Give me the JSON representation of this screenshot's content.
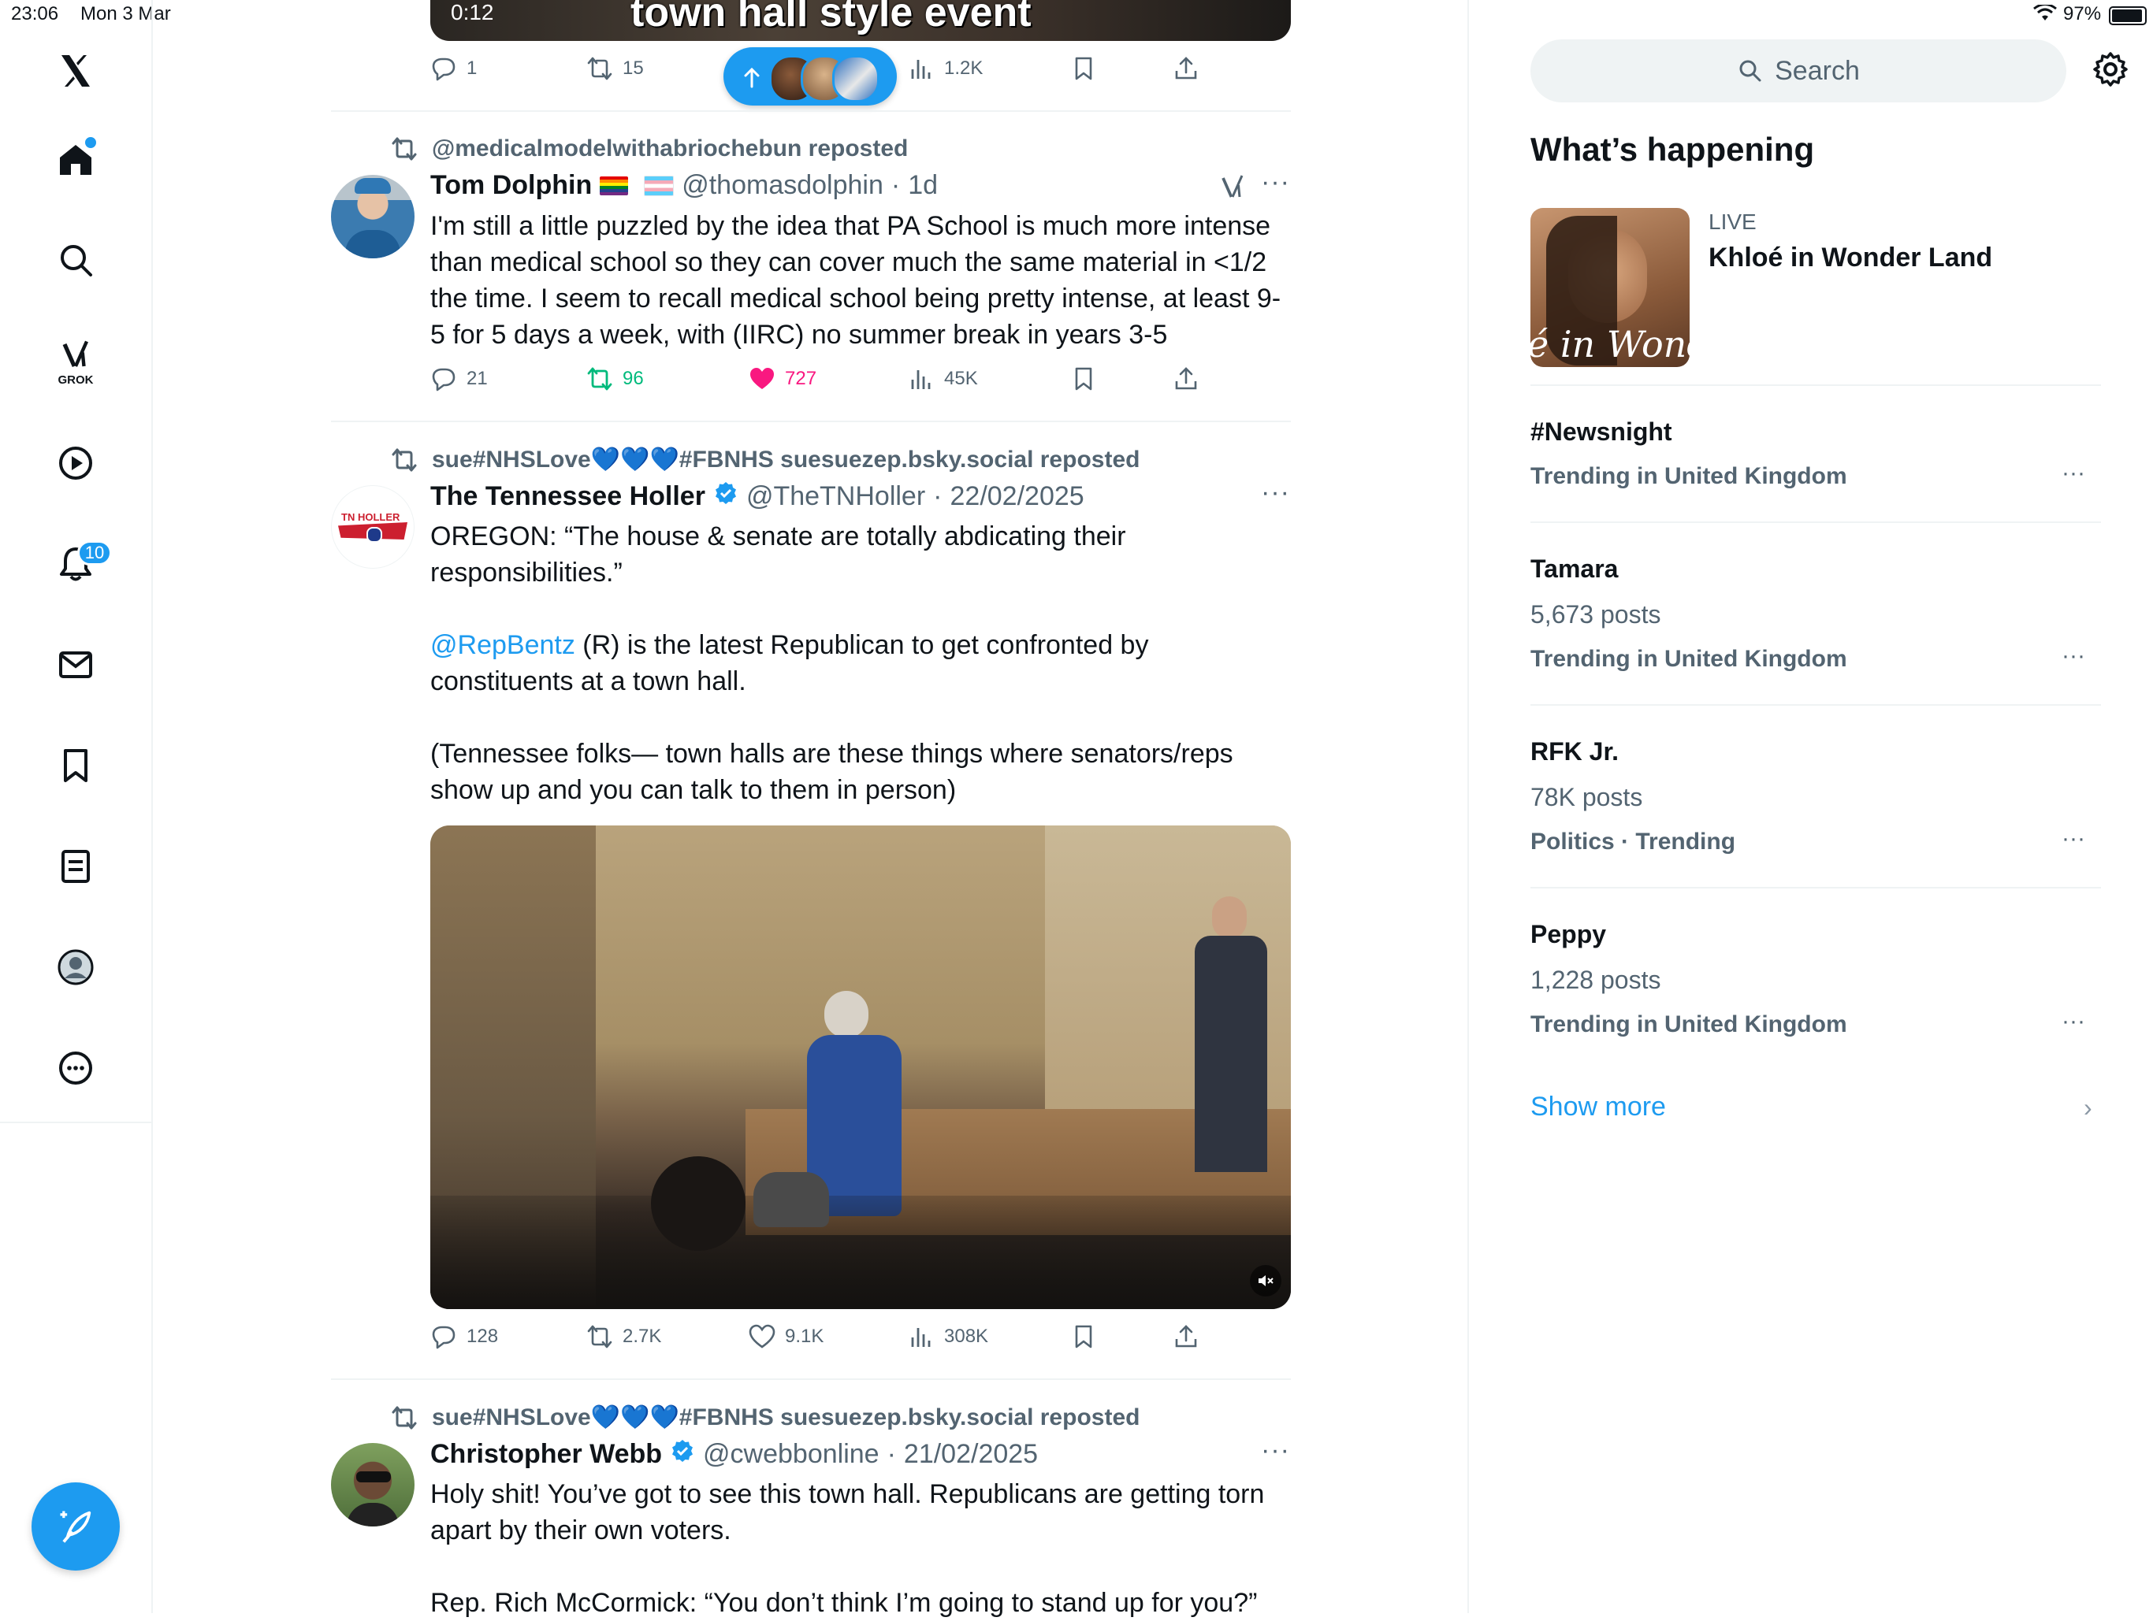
{
  "status_bar": {
    "time": "23:06",
    "date": "Mon 3 Mar",
    "battery": "97%"
  },
  "left_nav": {
    "logo": "x-logo-icon",
    "items": [
      {
        "icon": "home-icon",
        "has_dot": true
      },
      {
        "icon": "search-icon"
      },
      {
        "icon": "grok-icon",
        "label": "GROK"
      },
      {
        "icon": "video-icon"
      },
      {
        "icon": "bell-icon",
        "badge": "10"
      },
      {
        "icon": "mail-icon"
      },
      {
        "icon": "bookmark-icon"
      },
      {
        "icon": "lists-icon"
      },
      {
        "icon": "profile-icon"
      },
      {
        "icon": "more-icon"
      }
    ],
    "compose_icon": "compose-feather-icon"
  },
  "feed": {
    "top_video": {
      "time": "0:12",
      "caption": "town hall style event"
    },
    "top_actions": {
      "replies": "1",
      "reposts": "15",
      "views": "1.2K"
    },
    "tweets": [
      {
        "reposted_by": "@medicalmodelwithabriochebun reposted",
        "name": "Tom Dolphin",
        "handle": "@thomasdolphin",
        "time": "1d",
        "text": "I'm still a little puzzled by the idea that PA School is much more intense than medical school so they can cover much the same material in <1/2 the time. I seem to recall medical school being pretty intense, at least 9-5 for 5 days a week, with (IIRC) no summer break in years 3-5",
        "replies": "21",
        "reposts": "96",
        "likes": "727",
        "views": "45K"
      },
      {
        "reposted_by": "sue#NHSLove💙💙💙#FBNHS suesuezep.bsky.social reposted",
        "name": "The Tennessee Holler",
        "handle": "@TheTNHoller",
        "time": "22/02/2025",
        "avatar_text": "TN HOLLER",
        "text_1": "OREGON: “The house & senate are totally abdicating their responsibilities.”",
        "mention": "@RepBentz",
        "text_2": " (R) is the latest Republican to get confronted by constituents at a town hall.",
        "text_3": "(Tennessee folks— town halls are these things where senators/reps show up and you can talk to them in person)",
        "replies": "128",
        "reposts": "2.7K",
        "likes": "9.1K",
        "views": "308K"
      },
      {
        "reposted_by": "sue#NHSLove💙💙💙#FBNHS suesuezep.bsky.social reposted",
        "name": "Christopher Webb",
        "handle": "@cwebbonline",
        "time": "21/02/2025",
        "text_1": "Holy shit! You’ve got to see this town hall. Republicans are getting torn apart by their own voters.",
        "text_2": "Rep. Rich McCormick: “You don’t think I’m going to stand up for you?”"
      }
    ]
  },
  "sidebar": {
    "search_placeholder": "Search",
    "title": "What’s happening",
    "live": {
      "label": "LIVE",
      "title": "Khloé in Wonder Land",
      "thumb_text": "é in Wonder l"
    },
    "trends": [
      {
        "title": "#Newsnight",
        "posts": "",
        "meta": "Trending in United Kingdom"
      },
      {
        "title": "Tamara",
        "posts": "5,673 posts",
        "meta": "Trending in United Kingdom"
      },
      {
        "title": "RFK Jr.",
        "posts": "78K posts",
        "meta": "Politics · Trending"
      },
      {
        "title": "Peppy",
        "posts": "1,228 posts",
        "meta": "Trending in United Kingdom"
      }
    ],
    "show_more": "Show more"
  }
}
